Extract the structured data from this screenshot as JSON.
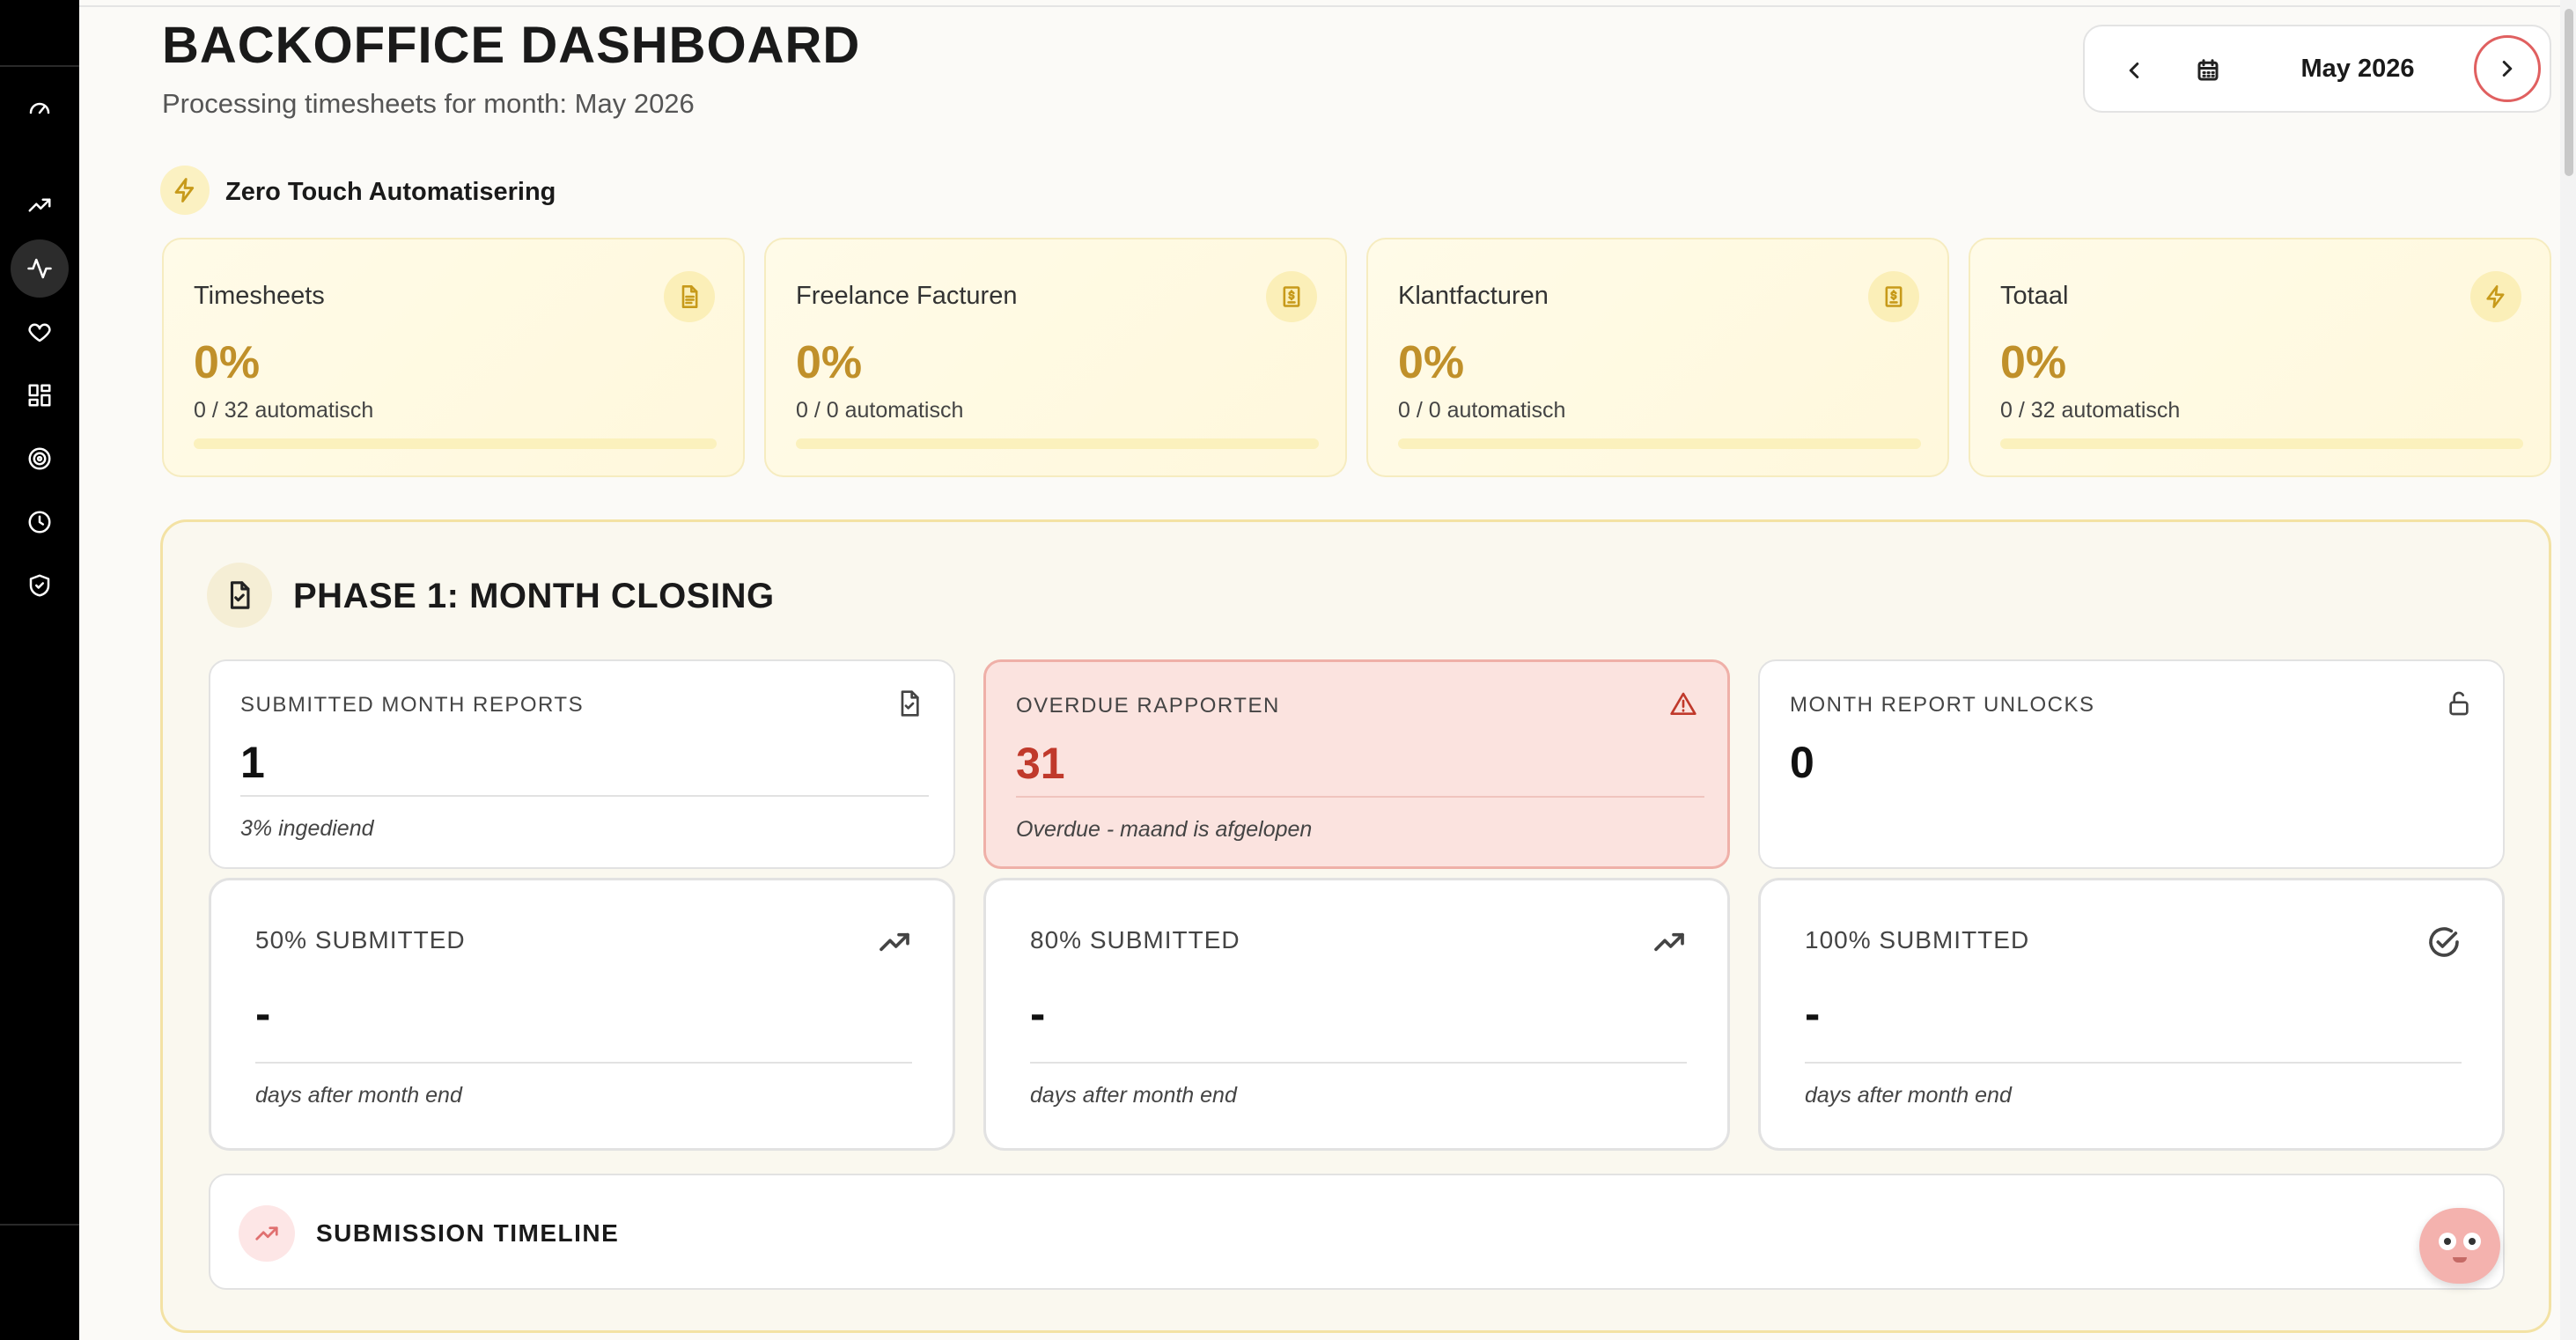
{
  "header": {
    "title": "BACKOFFICE DASHBOARD",
    "subtitle": "Processing timesheets for month: May 2026"
  },
  "month_nav": {
    "label": "May 2026",
    "prev_icon": "chevron-left-icon",
    "calendar_icon": "calendar-icon",
    "next_icon": "chevron-right-icon"
  },
  "sidebar": {
    "items": [
      {
        "icon": "gauge-icon",
        "active": false
      },
      {
        "icon": "trending-up-icon",
        "active": false
      },
      {
        "icon": "activity-icon",
        "active": true
      },
      {
        "icon": "heart-icon",
        "active": false
      },
      {
        "icon": "grid-icon",
        "active": false
      },
      {
        "icon": "target-icon",
        "active": false
      },
      {
        "icon": "clock-icon",
        "active": false
      },
      {
        "icon": "shield-check-icon",
        "active": false
      }
    ]
  },
  "zero_touch": {
    "title": "Zero Touch Automatisering",
    "cards": [
      {
        "name": "Timesheets",
        "percent": "0%",
        "sub": "0 / 32 automatisch",
        "progress": 0,
        "icon": "document-icon"
      },
      {
        "name": "Freelance Facturen",
        "percent": "0%",
        "sub": "0 / 0 automatisch",
        "progress": 0,
        "icon": "invoice-icon"
      },
      {
        "name": "Klantfacturen",
        "percent": "0%",
        "sub": "0 / 0 automatisch",
        "progress": 0,
        "icon": "invoice-icon"
      },
      {
        "name": "Totaal",
        "percent": "0%",
        "sub": "0 / 32 automatisch",
        "progress": 0,
        "icon": "lightning-icon"
      }
    ]
  },
  "phase1": {
    "title": "PHASE 1: MONTH CLOSING",
    "stats": [
      {
        "label": "SUBMITTED MONTH REPORTS",
        "value": "1",
        "note": "3% ingediend",
        "icon": "file-check-icon"
      },
      {
        "label": "OVERDUE RAPPORTEN",
        "value": "31",
        "note": "Overdue - maand is afgelopen",
        "icon": "warning-icon"
      },
      {
        "label": "MONTH REPORT UNLOCKS",
        "value": "0",
        "note": "",
        "icon": "unlock-icon"
      }
    ],
    "kpis": [
      {
        "label": "50% SUBMITTED",
        "value": "-",
        "note": "days after month end",
        "icon": "trending-up-icon"
      },
      {
        "label": "80% SUBMITTED",
        "value": "-",
        "note": "days after month end",
        "icon": "trending-up-icon"
      },
      {
        "label": "100% SUBMITTED",
        "value": "-",
        "note": "days after month end",
        "icon": "check-circle-icon"
      }
    ],
    "timeline": {
      "title": "SUBMISSION TIMELINE",
      "icon": "trending-up-icon"
    }
  },
  "colors": {
    "accent_gold": "#c0902a",
    "alert_red": "#c0392b",
    "sidebar_bg": "#000000"
  }
}
